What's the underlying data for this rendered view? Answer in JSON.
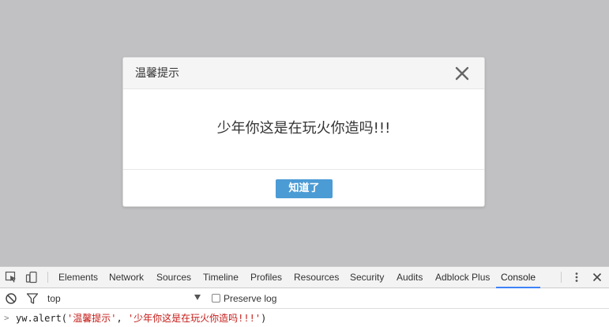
{
  "modal": {
    "title": "温馨提示",
    "message": "少年你这是在玩火你造吗!!!",
    "ok_label": "知道了",
    "close_icon": "close-icon"
  },
  "devtools": {
    "tabs": [
      {
        "label": "Elements"
      },
      {
        "label": "Network"
      },
      {
        "label": "Sources"
      },
      {
        "label": "Timeline"
      },
      {
        "label": "Profiles"
      },
      {
        "label": "Resources"
      },
      {
        "label": "Security"
      },
      {
        "label": "Audits"
      },
      {
        "label": "Adblock Plus"
      },
      {
        "label": "Console"
      }
    ],
    "active_tab": "Console",
    "context": "top",
    "preserve_log_label": "Preserve log",
    "preserve_log_checked": false,
    "console": {
      "prompt": ">",
      "code_prefix": "yw.alert(",
      "arg1": "'温馨提示'",
      "separator": ", ",
      "arg2": "'少年你这是在玩火你造吗!!!'",
      "code_suffix": ")"
    }
  },
  "colors": {
    "overlay": "#c1c1c3",
    "primary_button": "#4b9bd5",
    "active_tab_underline": "#3e82f7",
    "console_string": "#c41a16"
  }
}
